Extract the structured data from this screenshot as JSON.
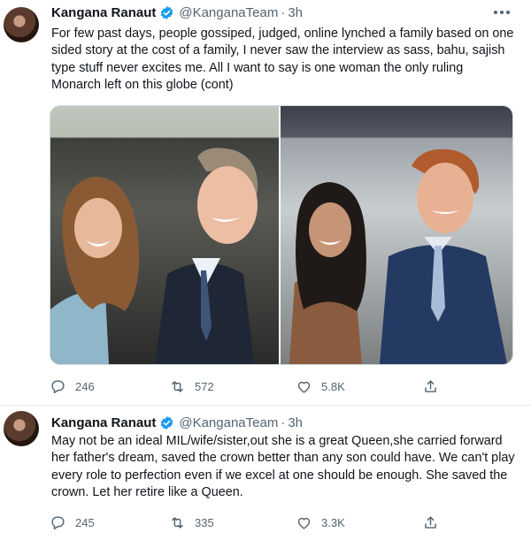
{
  "tweets": [
    {
      "author": {
        "name": "Kangana Ranaut",
        "handle": "@KanganaTeam",
        "time": "3h"
      },
      "text": "For few past days, people gossiped, judged, online lynched a family based on one sided story at the cost of a family, I never saw the interview as sass, bahu, sajish type stuff never excites me. All I want to say is one woman the only ruling Monarch left on this globe (cont)",
      "stats": {
        "replies": "246",
        "retweets": "572",
        "likes": "5.8K"
      }
    },
    {
      "author": {
        "name": "Kangana Ranaut",
        "handle": "@KanganaTeam",
        "time": "3h"
      },
      "text": "May not be an ideal MIL/wife/sister,out she is a great Queen,she carried forward her father's dream, saved the crown better than any son could have. We can't play every role to perfection even if we excel at one should be enough. She saved the crown. Let her retire like a Queen.",
      "stats": {
        "replies": "245",
        "retweets": "335",
        "likes": "3.3K"
      }
    }
  ],
  "separator": "·",
  "colors": {
    "verified": "#1d9bf0",
    "secondary_text": "#536471",
    "divider": "#e6ecf0"
  },
  "icons": [
    "verified-badge-icon",
    "more-options-icon",
    "reply-icon",
    "retweet-icon",
    "like-icon",
    "share-icon"
  ]
}
